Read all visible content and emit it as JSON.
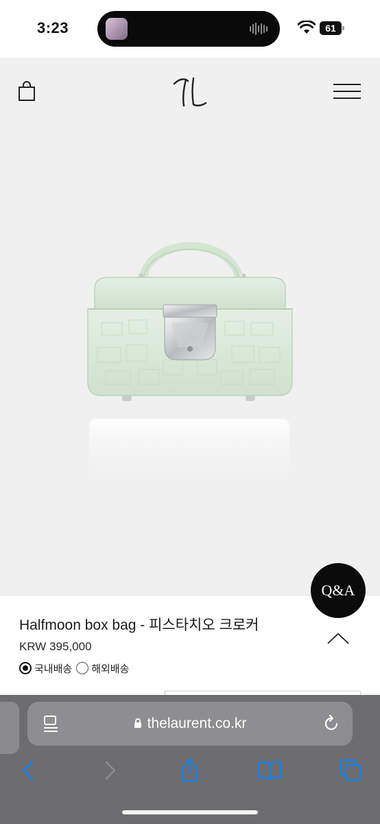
{
  "status_bar": {
    "time": "3:23",
    "battery": "61"
  },
  "header": {
    "logo": "TL"
  },
  "product": {
    "title": "Halfmoon box bag - 피스타치오 크로커",
    "price": "KRW 395,000",
    "color": "#d7e8d6"
  },
  "shipping_options": [
    {
      "label": "국내배송",
      "selected": true
    },
    {
      "label": "해외배송",
      "selected": false
    }
  ],
  "qa_button": {
    "label": "Q&A"
  },
  "browser": {
    "url": "thelaurent.co.kr"
  },
  "colors": {
    "hero_bg": "#f0f0f0",
    "browser_bar": "#6d6d6f",
    "address_bar": "#8e8e90",
    "toolbar_icon": "#0a84ff"
  }
}
